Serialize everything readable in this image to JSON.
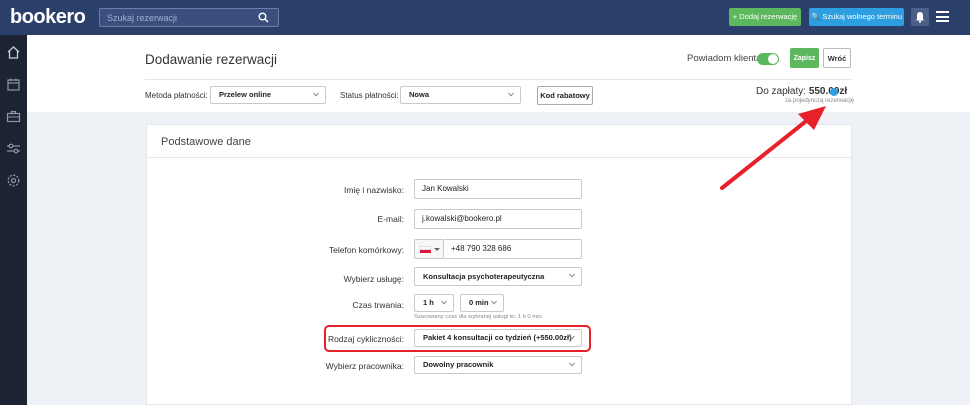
{
  "topbar": {
    "logo": "bookero",
    "search_placeholder": "Szukaj rezerwacji",
    "add_reservation": "+ Dodaj rezerwację",
    "find_free_term": "🔍 Szukaj wolnego terminu"
  },
  "sidebar": {
    "items": [
      "home-icon",
      "calendar-icon",
      "briefcase-icon",
      "sliders-icon",
      "gear-icon"
    ]
  },
  "header": {
    "title": "Dodawanie rezerwacji",
    "notify_label": "Powiadom klienta",
    "notify_on": true,
    "save_label": "Zapisz",
    "back_label": "Wróć",
    "payment_method_label": "Metoda płatności:",
    "payment_method_value": "Przelew online",
    "payment_status_label": "Status płatności:",
    "payment_status_value": "Nowa",
    "discount_label": "Kod rabatowy",
    "to_pay_label": "Do zapłaty:",
    "to_pay_amount": "550.00zł",
    "to_pay_sub": "za pojedynczą rezerwację"
  },
  "form": {
    "title": "Podstawowe dane",
    "name_label": "Imię i nazwisko:",
    "name_value": "Jan Kowalski",
    "email_label": "E-mail:",
    "email_value": "j.kowalski@bookero.pl",
    "phone_label": "Telefon komórkowy:",
    "phone_value": "+48 790 328 686",
    "service_label": "Wybierz usługę:",
    "service_value": "Konsultacja psychoterapeutyczna",
    "duration_label": "Czas trwania:",
    "duration_hours": "1 h",
    "duration_minutes": "0 min",
    "duration_hint": "Szacowany czas dla wybranej usługi to: 1 h 0 min.",
    "cycle_label": "Rodzaj cykliczności:",
    "cycle_value": "Pakiet 4 konsultacji co tydzień (+550.00zł)",
    "employee_label": "Wybierz pracownika:",
    "employee_value": "Dowolny pracownik"
  },
  "colors": {
    "topbar": "#2b3f6b",
    "sidebar": "#1c2333",
    "green": "#5cb85c",
    "blue": "#2d9fe0",
    "annotation_red": "#e8202a"
  }
}
